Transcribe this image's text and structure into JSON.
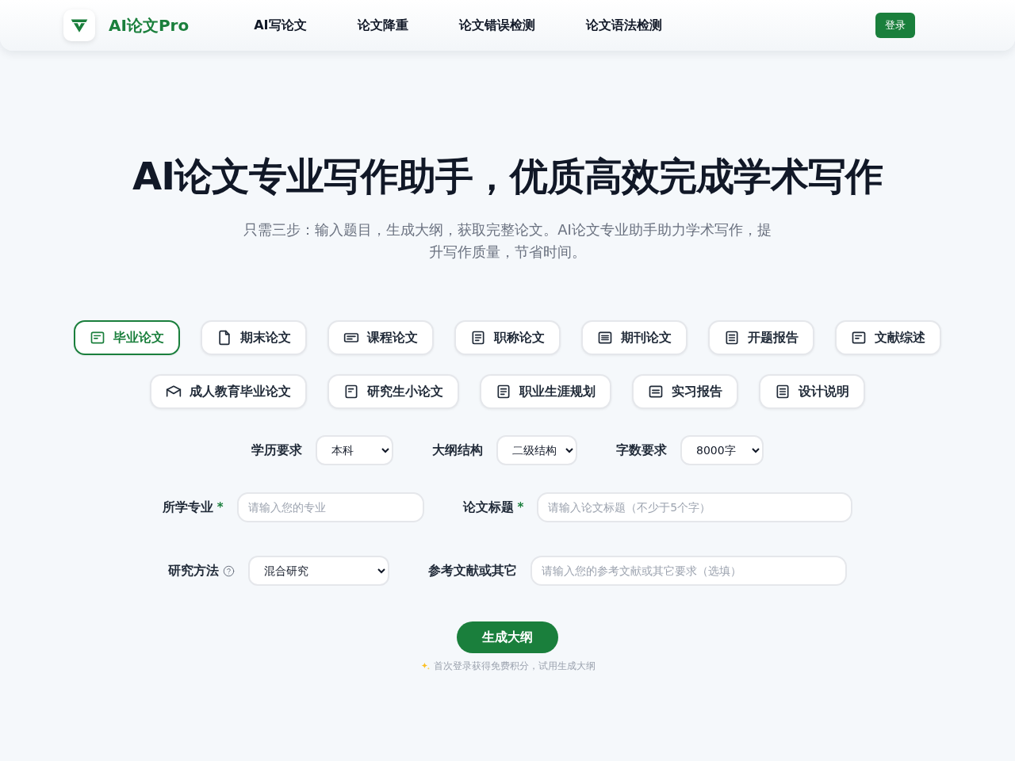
{
  "header": {
    "brand": "AI论文Pro",
    "nav": [
      "AI写论文",
      "论文降重",
      "论文错误检测",
      "论文语法检测"
    ],
    "login_button": "登录"
  },
  "hero": {
    "title": "AI论文专业写作助手，优质高效完成学术写作",
    "subtitle": "只需三步：输入题目，生成大纲，获取完整论文。AI论文专业助手助力学术写作，提升写作质量，节省时间。"
  },
  "paper_types": [
    {
      "label": "毕业论文",
      "selected": true
    },
    {
      "label": "期末论文",
      "selected": false
    },
    {
      "label": "课程论文",
      "selected": false
    },
    {
      "label": "职称论文",
      "selected": false
    },
    {
      "label": "期刊论文",
      "selected": false
    },
    {
      "label": "开题报告",
      "selected": false
    },
    {
      "label": "文献综述",
      "selected": false
    },
    {
      "label": "成人教育毕业论文",
      "selected": false
    },
    {
      "label": "研究生小论文",
      "selected": false
    },
    {
      "label": "职业生涯规划",
      "selected": false
    },
    {
      "label": "实习报告",
      "selected": false
    },
    {
      "label": "设计说明",
      "selected": false
    }
  ],
  "options": [
    {
      "label": "学历要求",
      "value": "本科"
    },
    {
      "label": "大纲结构",
      "value": "二级结构"
    },
    {
      "label": "字数要求",
      "value": "8000字"
    }
  ],
  "fields": [
    {
      "kind": "input",
      "label": "所学专业",
      "required_mark": "*",
      "placeholder": "请输入您的专业"
    },
    {
      "kind": "input",
      "label": "论文标题",
      "required_mark": "*",
      "placeholder": "请输入论文标题（不少于5个字）"
    },
    {
      "kind": "select",
      "label": "研究方法",
      "help": true,
      "value": "混合研究"
    },
    {
      "kind": "input",
      "label": "参考文献或其它",
      "placeholder": "请输入您的参考文献或其它要求（选填）"
    }
  ],
  "generate_button": "生成大纲",
  "hint": "首次登录获得免费积分，试用生成大纲"
}
